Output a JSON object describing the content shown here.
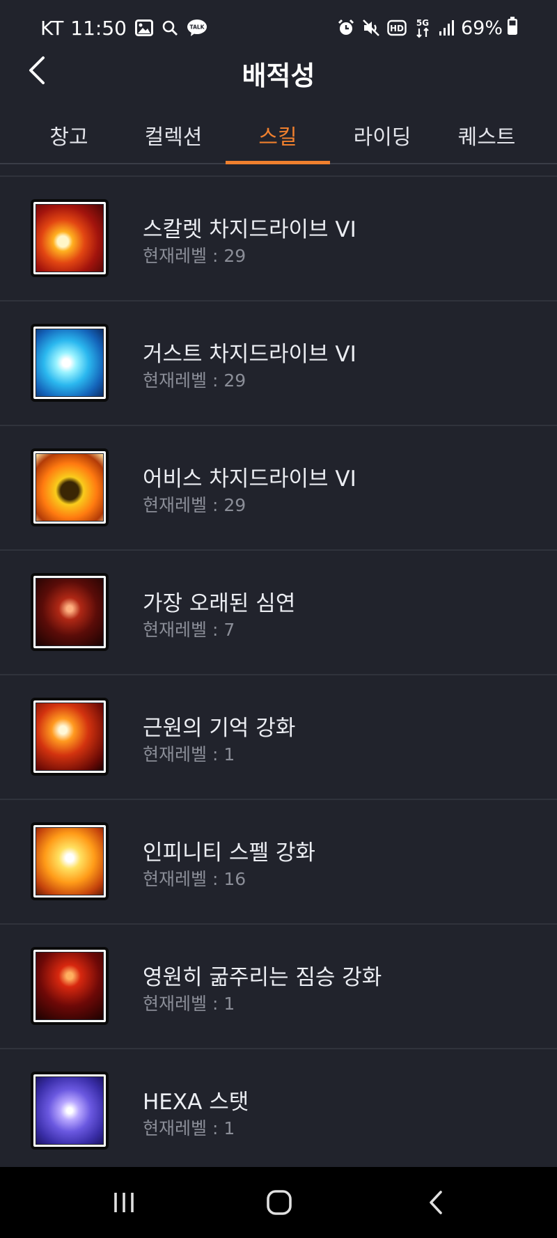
{
  "status_bar": {
    "carrier": "KT",
    "time": "11:50",
    "left_icons": [
      "image-icon",
      "search-icon",
      "talk-icon"
    ],
    "talk_label": "TALK",
    "right_icons": [
      "alarm-icon",
      "mute-icon",
      "hd-icon",
      "5g-icon",
      "signal-icon"
    ],
    "hd_label": "HD",
    "network_label": "5G",
    "battery": "69%"
  },
  "header": {
    "title": "배적성",
    "back_icon": "chevron-left-icon"
  },
  "tabs": [
    {
      "label": "창고",
      "active": false
    },
    {
      "label": "컬렉션",
      "active": false
    },
    {
      "label": "스킬",
      "active": true
    },
    {
      "label": "라이딩",
      "active": false
    },
    {
      "label": "퀘스트",
      "active": false
    }
  ],
  "colors": {
    "background": "#21232c",
    "accent": "#f0802e",
    "divider": "#30333c",
    "secondary_text": "#8b8e98"
  },
  "skills": [
    {
      "name": "스칼렛 차지드라이브 VI",
      "level": "현재레벨 : 29",
      "icon": "scarlet-chargedrive-icon"
    },
    {
      "name": "거스트 차지드라이브 VI",
      "level": "현재레벨 : 29",
      "icon": "gust-chargedrive-icon"
    },
    {
      "name": "어비스 차지드라이브 VI",
      "level": "현재레벨 : 29",
      "icon": "abyss-chargedrive-icon"
    },
    {
      "name": "가장 오래된 심연",
      "level": "현재레벨 : 7",
      "icon": "oldest-abyss-icon"
    },
    {
      "name": "근원의 기억 강화",
      "level": "현재레벨 : 1",
      "icon": "origin-memory-icon"
    },
    {
      "name": "인피니티 스펠 강화",
      "level": "현재레벨 : 16",
      "icon": "infinity-spell-icon"
    },
    {
      "name": "영원히 굶주리는 짐승 강화",
      "level": "현재레벨 : 1",
      "icon": "hungry-beast-icon"
    },
    {
      "name": "HEXA 스탯",
      "level": "현재레벨 : 1",
      "icon": "hexa-stat-icon"
    }
  ],
  "nav_bar": {
    "buttons": [
      "recent-apps-icon",
      "home-icon",
      "back-icon"
    ]
  }
}
